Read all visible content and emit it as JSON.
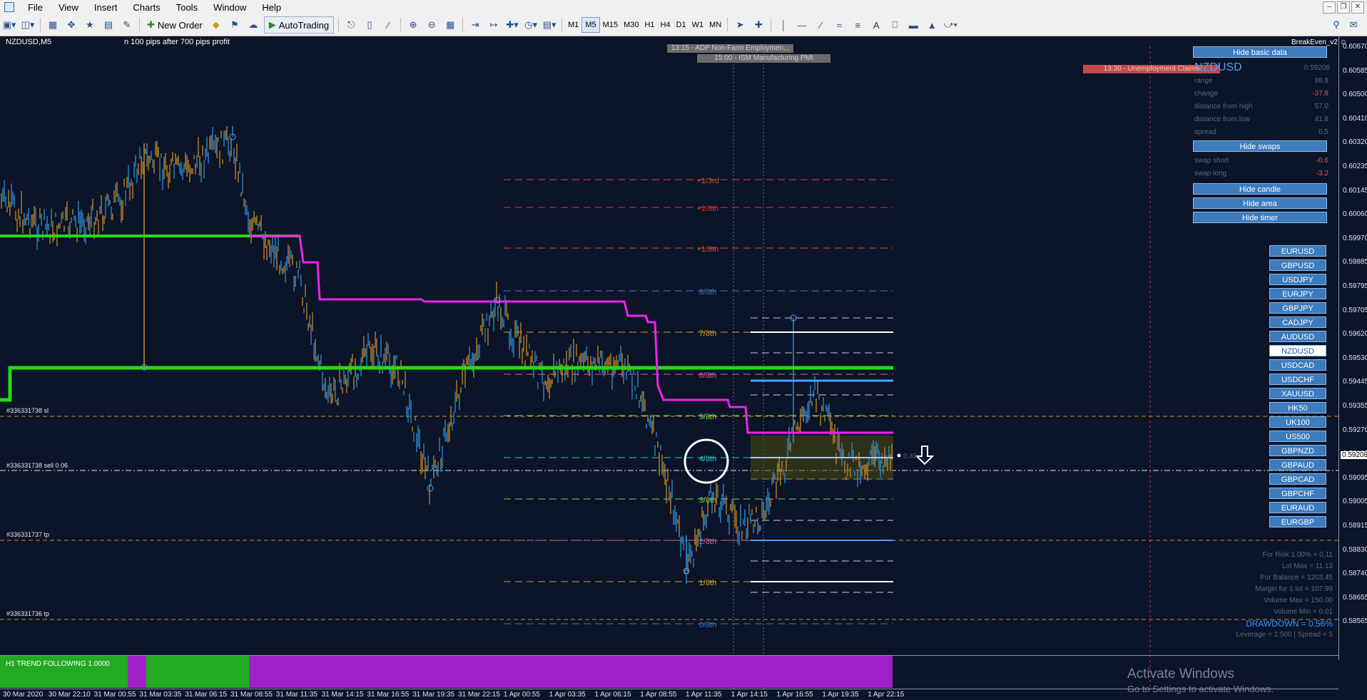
{
  "menu": {
    "items": [
      "File",
      "View",
      "Insert",
      "Charts",
      "Tools",
      "Window",
      "Help"
    ]
  },
  "toolbar": {
    "new_order": "New Order",
    "autotrading": "AutoTrading",
    "timeframes": [
      "M1",
      "M5",
      "M15",
      "M30",
      "H1",
      "H4",
      "D1",
      "W1",
      "MN"
    ],
    "active_timeframe": "M5"
  },
  "chart": {
    "symbol_tf": "NZDUSD,M5",
    "subtitle": "n 100 pips after 700 pips profit",
    "ea_name": "BreakEven_v2",
    "current_price": "0.59208",
    "order_labels": {
      "sl": "#336331738 sl",
      "sell": "#336331738 sell 0.06",
      "tp1": "#336331737 tp",
      "tp2": "#336331736 tp"
    },
    "news": {
      "adp": "13:15 - ADP Non-Farm Employmen...",
      "ism": "15:00 - ISM Manufacturing PMI",
      "unemployment": "13:30 - Unemployment Claims"
    },
    "murrey": [
      "+1/3rd",
      "+2/8th",
      "+1/8th",
      "8/8th",
      "7/8th",
      "6/8th",
      "5/8th",
      "4/8th",
      "3/8th",
      "2/8th",
      "1/8th",
      "0/8th"
    ],
    "price_hint": "0.49"
  },
  "yaxis": {
    "labels": [
      "0.60670",
      "0.60585",
      "0.60500",
      "0.60410",
      "0.60320",
      "0.60235",
      "0.60145",
      "0.60060",
      "0.59970",
      "0.59885",
      "0.59795",
      "0.59705",
      "0.59620",
      "0.59530",
      "0.59445",
      "0.59355",
      "0.59270",
      "0.59180",
      "0.59095",
      "0.59005",
      "0.58915",
      "0.58830",
      "0.58740",
      "0.58655",
      "0.58565"
    ]
  },
  "xaxis": {
    "labels": [
      "30 Mar 2020",
      "30 Mar 22:10",
      "31 Mar 00:55",
      "31 Mar 03:35",
      "31 Mar 06:15",
      "31 Mar 08:55",
      "31 Mar 11:35",
      "31 Mar 14:15",
      "31 Mar 16:55",
      "31 Mar 19:35",
      "31 Mar 22:15",
      "1 Apr 00:55",
      "1 Apr 03:35",
      "1 Apr 06:15",
      "1 Apr 08:55",
      "1 Apr 11:35",
      "1 Apr 14:15",
      "1 Apr 16:55",
      "1 Apr 19:35",
      "1 Apr 22:15"
    ]
  },
  "panel": {
    "hide_basic": "Hide basic data",
    "symbol": "NZDUSD",
    "symbol_price": "0.59208",
    "rows": [
      {
        "label": "range",
        "value": "98.8",
        "color": "#5b6a86"
      },
      {
        "label": "change",
        "value": "-37.8",
        "color": "#ff4a4a"
      },
      {
        "label": "distance from high",
        "value": "57.0",
        "color": "#5b6a86"
      },
      {
        "label": "distance from low",
        "value": "41.8",
        "color": "#5b6a86"
      },
      {
        "label": "spread",
        "value": "0.5",
        "color": "#5b6a86"
      }
    ],
    "hide_swaps": "Hide swaps",
    "swaps": [
      {
        "label": "swap short",
        "value": "-0.6",
        "color": "#ff4a4a"
      },
      {
        "label": "swap long",
        "value": "-3.2",
        "color": "#ff4a4a"
      }
    ],
    "hide_candle": "Hide candle",
    "hide_area": "Hide area",
    "hide_timer": "Hide timer"
  },
  "symbols": [
    "EURUSD",
    "GBPUSD",
    "USDJPY",
    "EURJPY",
    "GBPJPY",
    "CADJPY",
    "AUDUSD",
    "NZDUSD",
    "USDCAD",
    "USDCHF",
    "XAUUSD",
    "HK50",
    "UK100",
    "US500",
    "GBPNZD",
    "GBPAUD",
    "GBPCAD",
    "GBPCHF",
    "EURAUD",
    "EURGBP"
  ],
  "active_symbol": "NZDUSD",
  "risk": {
    "lines": [
      "For Risk 1.00% = 0.11",
      "Lot Max = 11.13",
      "For Balance = 1203.45",
      "Margin for 1 lot = 107.99",
      "Volume Max = 150.00",
      "Volume Min = 0.01"
    ],
    "drawdown": "DRAWDOWN = 0.56%",
    "leverage": "Leverage = 1:500 | Spread = 5"
  },
  "indicator": {
    "label": "H1 TREND FOLLOWING 1.0000"
  },
  "watermark": {
    "title": "Activate Windows",
    "subtitle": "Go to Settings to activate Windows."
  },
  "colors": {
    "background": "#0b1428",
    "green_line": "#22dd11",
    "magenta_line": "#ee22ee",
    "bull": "#2e8fd8",
    "bear": "#c88a24"
  }
}
